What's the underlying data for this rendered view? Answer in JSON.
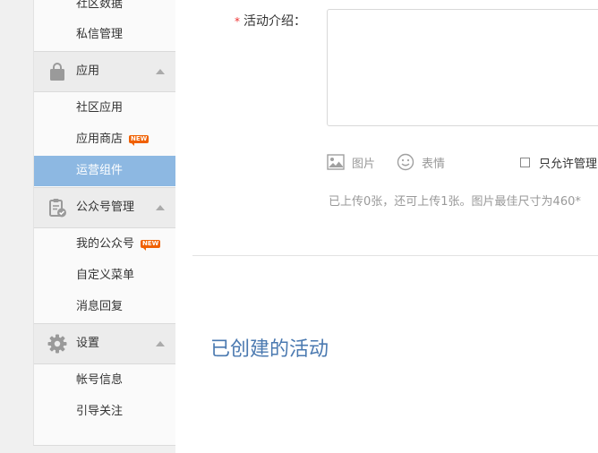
{
  "sidebar": {
    "items_top": [
      {
        "label": "社区数据"
      },
      {
        "label": "私信管理"
      }
    ],
    "groups": [
      {
        "label": "应用",
        "icon": "bag-icon",
        "items": [
          {
            "label": "社区应用",
            "badge": ""
          },
          {
            "label": "应用商店",
            "badge": "NEW"
          },
          {
            "label": "运营组件",
            "badge": "",
            "active": true
          }
        ]
      },
      {
        "label": "公众号管理",
        "icon": "clipboard-check-icon",
        "items": [
          {
            "label": "我的公众号",
            "badge": "NEW"
          },
          {
            "label": "自定义菜单",
            "badge": ""
          },
          {
            "label": "消息回复",
            "badge": ""
          }
        ]
      },
      {
        "label": "设置",
        "icon": "gear-icon",
        "items": [
          {
            "label": "帐号信息",
            "badge": ""
          },
          {
            "label": "引导关注",
            "badge": ""
          }
        ]
      }
    ]
  },
  "form": {
    "intro_required_mark": "*",
    "intro_label": "活动介绍：",
    "intro_value": "",
    "tool_image_label": "图片",
    "tool_emoji_label": "表情",
    "only_allow_label": "只允许管理",
    "upload_hint": "已上传0张，还可上传1张。图片最佳尺寸为460*"
  },
  "created": {
    "title": "已创建的活动"
  },
  "colors": {
    "active_bg": "#8db8e2",
    "badge": "#f06000",
    "title_blue": "#4a79b0",
    "required": "#e33333"
  }
}
